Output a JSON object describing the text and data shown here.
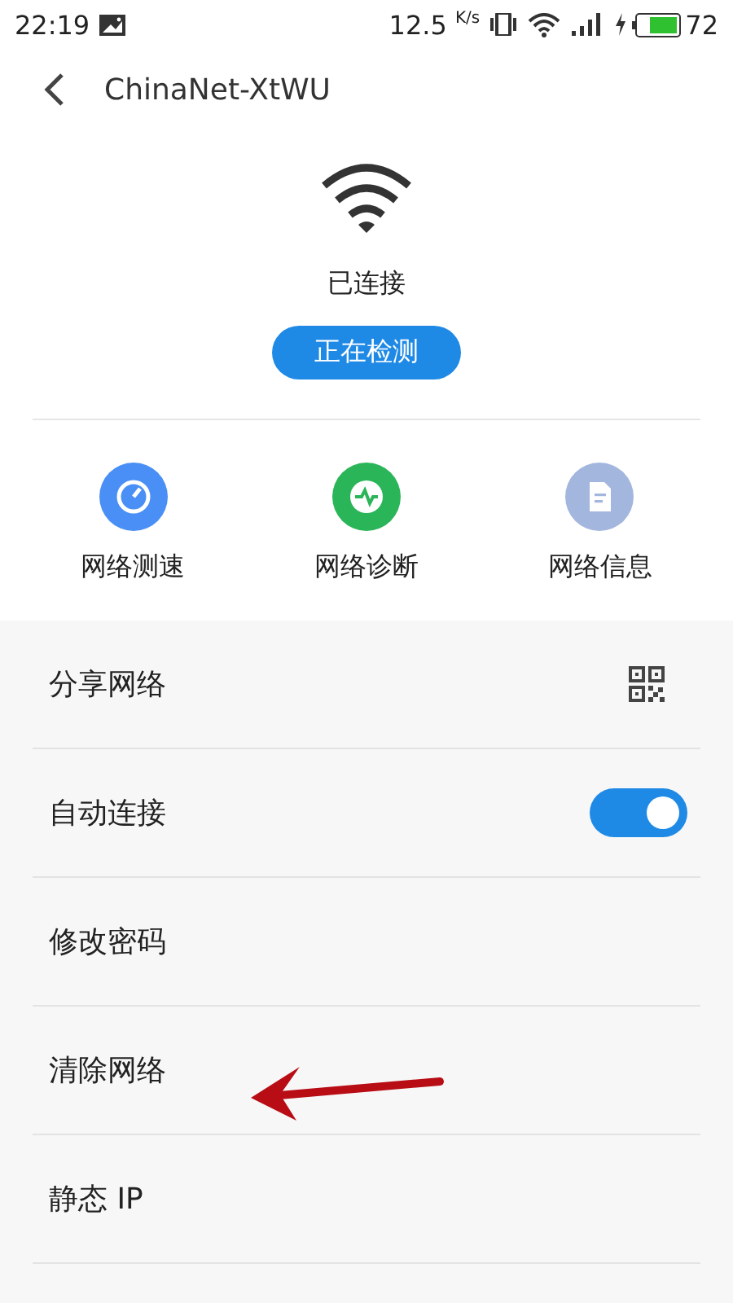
{
  "status_bar": {
    "time": "22:19",
    "speed": "12.5",
    "speed_unit": "K/s",
    "battery": "72"
  },
  "header": {
    "title": "ChinaNet-XtWU"
  },
  "connection": {
    "status": "已连接",
    "button": "正在检测"
  },
  "actions": [
    {
      "label": "网络测速",
      "kind": "speed",
      "color": "#4a8ff5"
    },
    {
      "label": "网络诊断",
      "kind": "diagnose",
      "color": "#2bb559"
    },
    {
      "label": "网络信息",
      "kind": "info",
      "color": "#a3b6dd"
    }
  ],
  "settings": [
    {
      "label": "分享网络",
      "kind": "qr"
    },
    {
      "label": "自动连接",
      "kind": "toggle",
      "on": true
    },
    {
      "label": "修改密码",
      "kind": "plain"
    },
    {
      "label": "清除网络",
      "kind": "plain"
    },
    {
      "label": "静态 IP",
      "kind": "plain"
    }
  ]
}
